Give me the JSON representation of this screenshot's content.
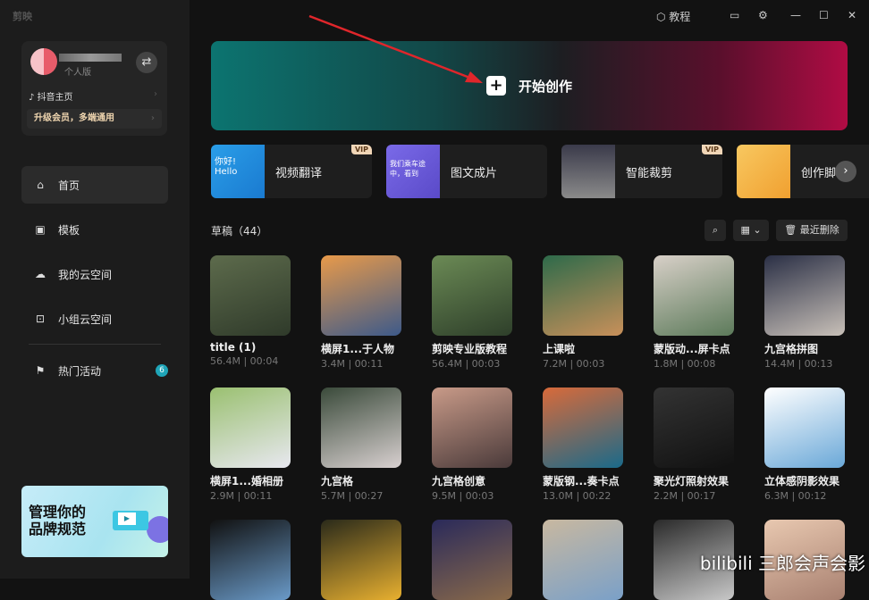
{
  "app": {
    "logo": "剪映"
  },
  "user": {
    "edition": "个人版",
    "douyin": "抖音主页",
    "upgrade": "升级会员，多端通用"
  },
  "nav": [
    {
      "label": "首页",
      "icon": "home-icon"
    },
    {
      "label": "模板",
      "icon": "template-icon"
    },
    {
      "label": "我的云空间",
      "icon": "cloud-icon"
    },
    {
      "label": "小组云空间",
      "icon": "group-cloud-icon"
    },
    {
      "label": "热门活动",
      "icon": "flag-icon",
      "badge": "6"
    }
  ],
  "promo": {
    "title_line1": "管理你的",
    "title_line2": "品牌规范"
  },
  "topbar": {
    "tutorial": "教程"
  },
  "banner": {
    "label": "开始创作"
  },
  "tools": [
    {
      "label": "视频翻译",
      "vip": "VIP",
      "thumb_text": "你好! Hello"
    },
    {
      "label": "图文成片",
      "thumb_text": "我们乘车途中，看到"
    },
    {
      "label": "智能裁剪",
      "vip": "VIP"
    },
    {
      "label": "创作脚本"
    }
  ],
  "drafts": {
    "title": "草稿（44）",
    "recent_delete": "最近删除",
    "items": [
      {
        "name": "title (1)",
        "meta": "56.4M | 00:04",
        "c1": "#5d6b4c",
        "c2": "#2f3a2a"
      },
      {
        "name": "横屏1...于人物",
        "meta": "3.4M | 00:11",
        "c1": "#e89a4a",
        "c2": "#3d5a8a"
      },
      {
        "name": "剪映专业版教程",
        "meta": "56.4M | 00:03",
        "c1": "#6b8a55",
        "c2": "#2e3f2a"
      },
      {
        "name": "上课啦",
        "meta": "7.2M | 00:03",
        "c1": "#2e6a4a",
        "c2": "#c8905a"
      },
      {
        "name": "蒙版动...屏卡点",
        "meta": "1.8M | 00:08",
        "c1": "#d8d0c8",
        "c2": "#5c7a5a"
      },
      {
        "name": "九宫格拼图",
        "meta": "14.4M | 00:13",
        "c1": "#2a2f45",
        "c2": "#c8c0b8"
      },
      {
        "name": "横屏1...婚相册",
        "meta": "2.9M | 00:11",
        "c1": "#9ac070",
        "c2": "#e8e8f0"
      },
      {
        "name": "九宫格",
        "meta": "5.7M | 00:27",
        "c1": "#3a4a3a",
        "c2": "#d8d0d0"
      },
      {
        "name": "九宫格创意",
        "meta": "9.5M | 00:03",
        "c1": "#c89a88",
        "c2": "#4a3a3a"
      },
      {
        "name": "蒙版钢...奏卡点",
        "meta": "13.0M | 00:22",
        "c1": "#d86a3a",
        "c2": "#1a6a8a"
      },
      {
        "name": "聚光灯照射效果",
        "meta": "2.2M | 00:17",
        "c1": "#333",
        "c2": "#111"
      },
      {
        "name": "立体感阴影效果",
        "meta": "6.3M | 00:12",
        "c1": "#ffffff",
        "c2": "#6aa8d8"
      },
      {
        "c1": "#111",
        "c2": "#6a9ac8"
      },
      {
        "c1": "#2a2a1a",
        "c2": "#e8b030"
      },
      {
        "c1": "#2a2a5a",
        "c2": "#8a6a4a"
      },
      {
        "c1": "#c8b8a0",
        "c2": "#7aa0c8"
      },
      {
        "c1": "#2a2a2a",
        "c2": "#c8c8c8"
      },
      {
        "c1": "#e8c8b0",
        "c2": "#a88070"
      }
    ]
  },
  "watermark": "bilibili 三郎会声会影"
}
